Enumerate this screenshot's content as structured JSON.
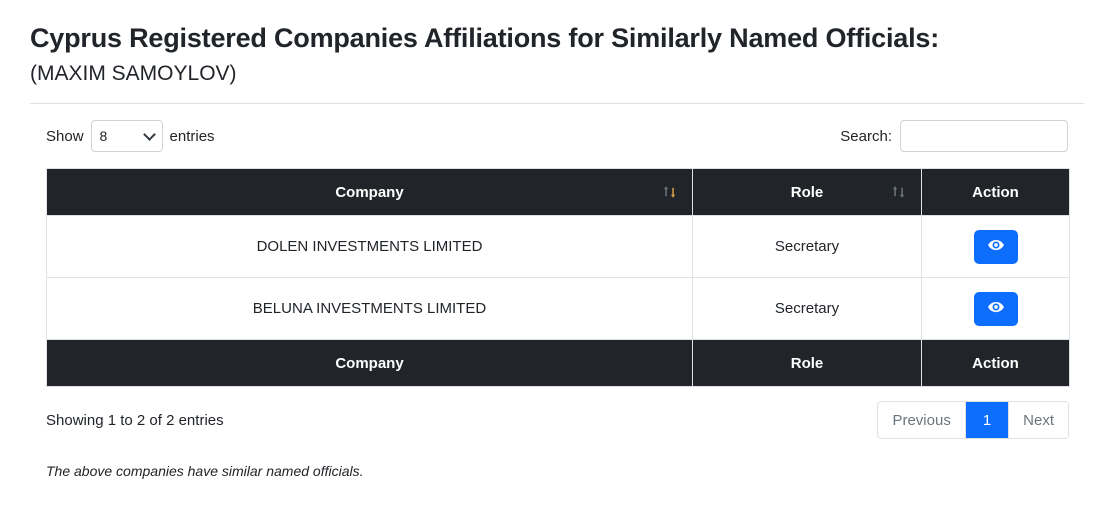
{
  "header": {
    "title": "Cyprus Registered Companies Affiliations for Similarly Named Officials:",
    "subtitle": "(MAXIM SAMOYLOV)"
  },
  "controls": {
    "show_label": "Show",
    "entries_label": "entries",
    "entries_value": "8",
    "entries_options": [
      "8"
    ],
    "dropdown_icon": "chevron-down-icon",
    "search_label": "Search:",
    "search_value": "",
    "search_placeholder": ""
  },
  "table": {
    "columns": [
      {
        "label": "Company",
        "sortable": true,
        "sort_state": "descending"
      },
      {
        "label": "Role",
        "sortable": true,
        "sort_state": "none"
      },
      {
        "label": "Action",
        "sortable": false,
        "sort_state": "none"
      }
    ],
    "rows": [
      {
        "company": "DOLEN INVESTMENTS LIMITED",
        "role": "Secretary",
        "action_icon": "eye-icon"
      },
      {
        "company": "BELUNA INVESTMENTS LIMITED",
        "role": "Secretary",
        "action_icon": "eye-icon"
      }
    ],
    "footer_columns": [
      {
        "label": "Company"
      },
      {
        "label": "Role"
      },
      {
        "label": "Action"
      }
    ]
  },
  "footer": {
    "info": "Showing 1 to 2 of 2 entries",
    "pagination": {
      "previous_label": "Previous",
      "page_label": "1",
      "next_label": "Next"
    },
    "note": "The above companies have similar named officials."
  },
  "colors": {
    "header_bg": "#212529",
    "primary": "#0d6efd",
    "sort_active": "#d6a14a",
    "sort_inactive": "#6c757d",
    "border": "#dee2e6"
  }
}
